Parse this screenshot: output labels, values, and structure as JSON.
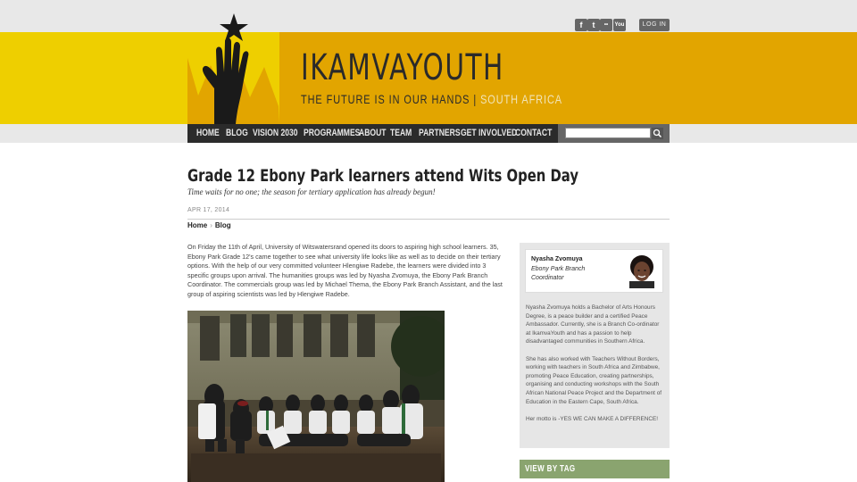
{
  "header": {
    "site_name": "IKAMVAYOUTH",
    "tagline_main": "THE FUTURE IS IN OUR HANDS | ",
    "tagline_region": "SOUTH AFRICA",
    "login_label": "LOG IN",
    "social": [
      {
        "icon": "facebook-icon",
        "glyph": "f"
      },
      {
        "icon": "twitter-icon",
        "glyph": "t"
      },
      {
        "icon": "flickr-icon",
        "glyph": "••"
      },
      {
        "icon": "youtube-icon",
        "glyph": "You"
      }
    ],
    "colors": {
      "banner_yellow": "#eecf00",
      "banner_gold": "#e2a500",
      "nav_dark": "#2b2b2b",
      "tag_green": "#8aa46f"
    }
  },
  "nav": {
    "items": [
      "HOME",
      "BLOG",
      "VISION 2030",
      "PROGRAMMES",
      "ABOUT",
      "TEAM",
      "PARTNERS",
      "GET INVOLVED",
      "CONTACT"
    ]
  },
  "search": {
    "placeholder": "",
    "icon": "search-icon"
  },
  "post": {
    "title": "Grade 12 Ebony Park learners attend Wits Open Day",
    "subtitle": "Time waits for no one; the season for tertiary application has already begun!",
    "date": "APR 17, 2014",
    "breadcrumb": [
      "Home",
      "Blog"
    ],
    "breadcrumb_sep": "›",
    "body": "On Friday the 11th of April, University of Witswatersrand opened its doors to aspiring high school learners. 35, Ebony Park Grade 12's came together to see what university life looks like as well as to decide on their tertiary options. With the help of our very committed volunteer Hlengiwe Radebe, the learners were divided into 3 specific groups upon arrival. The humanities groups was led by Nyasha Zvomuya, the Ebony Park Branch Coordinator. The commercials group was led by Michael Thema, the Ebony Park Branch Assistant, and the last group of aspiring scientists was led by Hlengiwe Radebe."
  },
  "author": {
    "name": "Nyasha Zvomuya",
    "role": "Ebony Park Branch Coordinator",
    "bio": [
      "Nyasha Zvomuya holds a Bachelor of Arts Honours Degree, is a peace builder and a certified Peace Ambassador. Currently, she is a Branch Co-ordinator at IkamvaYouth and has a passion to help disadvantaged communities in Southern Africa.",
      "She has also worked with Teachers Without Borders, working with teachers in South Africa and Zimbabwe, promoting Peace Education, creating partnerships, organising and conducting workshops with the South African National Peace Project and the Department of Education in the Eastern Cape, South Africa.",
      "Her motto is -YES WE CAN MAKE A DIFFERENCE!"
    ]
  },
  "sidebar": {
    "tag_heading": "VIEW BY TAG"
  }
}
